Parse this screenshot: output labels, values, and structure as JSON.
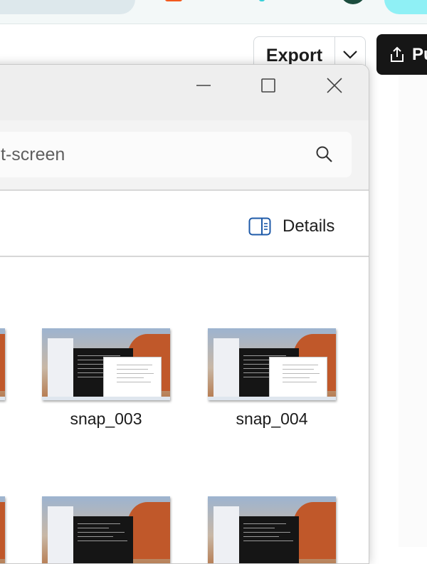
{
  "background_app": {
    "export_label": "Export",
    "publish_label": "Pu",
    "colors": {
      "publish_bg": "#161616",
      "orange": "#f25a1f",
      "teal": "#8ff0f5",
      "avatar": "#1b4d3e"
    }
  },
  "window": {
    "search": {
      "text": "t-screen"
    },
    "command_bar": {
      "details_label": "Details"
    }
  },
  "files": [
    {
      "name": "snap_003"
    },
    {
      "name": "snap_004"
    }
  ],
  "icons": [
    "minimize-icon",
    "maximize-icon",
    "close-icon",
    "search-icon",
    "details-pane-icon",
    "share-icon",
    "chevron-down-icon"
  ]
}
